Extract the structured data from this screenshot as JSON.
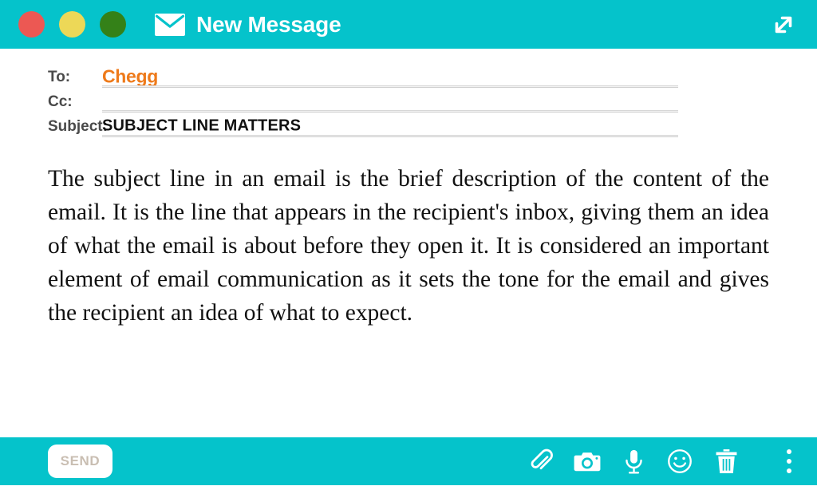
{
  "titlebar": {
    "title": "New Message",
    "mail_icon": "envelope-icon",
    "expand_icon": "expand-arrows-icon",
    "background_color": "#05C3CB",
    "traffic_lights": [
      {
        "name": "close",
        "color": "#EC5853"
      },
      {
        "name": "minimize",
        "color": "#EDD857"
      },
      {
        "name": "zoom",
        "color": "#348118"
      }
    ]
  },
  "compose": {
    "fields": [
      {
        "label": "To:",
        "value": "Chegg",
        "value_color": "#EE7A1A"
      },
      {
        "label": "Cc:",
        "value": "",
        "value_color": "#111111"
      },
      {
        "label": "Subject:",
        "value": "SUBJECT LINE MATTERS",
        "value_color": "#111111"
      }
    ],
    "body": "The subject line in an email is the brief description of the content of the email. It is the line that appears in the recipient's inbox, giving them an idea of what the email is about before they open it. It is considered an important element of email communication as it sets the tone for the email and gives the recipient an idea of what to expect."
  },
  "bottombar": {
    "send_label": "SEND",
    "background_color": "#05C3CB",
    "tools": [
      {
        "name": "attachment-icon",
        "label": "Attach file"
      },
      {
        "name": "camera-icon",
        "label": "Insert photo"
      },
      {
        "name": "microphone-icon",
        "label": "Record audio"
      },
      {
        "name": "emoji-icon",
        "label": "Insert emoji"
      },
      {
        "name": "trash-icon",
        "label": "Discard draft"
      }
    ],
    "more_icon": "more-vertical-icon"
  }
}
